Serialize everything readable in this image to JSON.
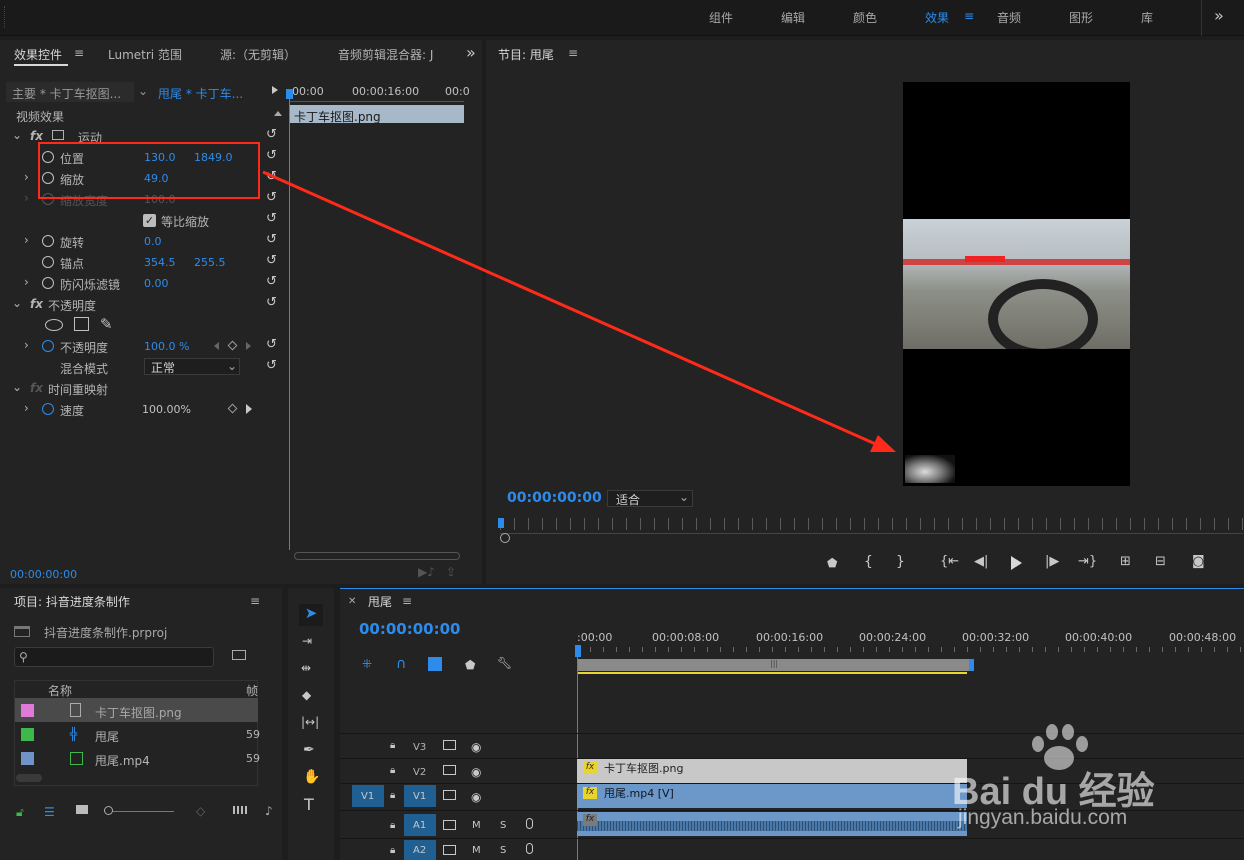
{
  "workspaces": {
    "items": [
      "组件",
      "编辑",
      "颜色",
      "效果",
      "音频",
      "图形",
      "库"
    ],
    "active": "效果",
    "more": "»"
  },
  "ec": {
    "tabs": [
      "效果控件",
      "Lumetri 范围",
      "源:（无剪辑）",
      "音频剪辑混合器: J"
    ],
    "more": "»",
    "master": "主要 * 卡丁车抠图...",
    "clip": "甩尾 * 卡丁车...",
    "ruler": [
      "00:00",
      "00:00:16:00",
      "00:0"
    ],
    "clip_bar": "卡丁车抠图.png",
    "video_effects": "视频效果",
    "motion": "运动",
    "position": {
      "label": "位置",
      "x": "130.0",
      "y": "1849.0"
    },
    "scale": {
      "label": "缩放",
      "value": "49.0"
    },
    "scale_width": {
      "label": "缩放宽度",
      "value": "100.0"
    },
    "uniform": "等比缩放",
    "rotation": {
      "label": "旋转",
      "value": "0.0"
    },
    "anchor": {
      "label": "锚点",
      "x": "354.5",
      "y": "255.5"
    },
    "flicker": {
      "label": "防闪烁滤镜",
      "value": "0.00"
    },
    "opacity_group": "不透明度",
    "opacity": {
      "label": "不透明度",
      "value": "100.0 %"
    },
    "blend": {
      "label": "混合模式",
      "value": "正常"
    },
    "time_remap": "时间重映射",
    "speed": {
      "label": "速度",
      "value": "100.00%"
    },
    "timecode": "00:00:00:00"
  },
  "program": {
    "title": "节目: 甩尾",
    "timecode": "00:00:00:00",
    "fit": "适合"
  },
  "project": {
    "title": "项目: 抖音进度条制作",
    "file": "抖音进度条制作.prproj",
    "col_name": "名称",
    "col_fps": "帧",
    "items": [
      {
        "name": "卡丁车抠图.png",
        "color": "#e07ad8",
        "fps": ""
      },
      {
        "name": "甩尾",
        "color": "#3db84a",
        "fps": "59"
      },
      {
        "name": "甩尾.mp4",
        "color": "#6e94c8",
        "fps": "59"
      }
    ]
  },
  "timeline": {
    "title": "甩尾",
    "timecode": "00:00:00:00",
    "ruler": [
      ":00:00",
      "00:00:08:00",
      "00:00:16:00",
      "00:00:24:00",
      "00:00:32:00",
      "00:00:40:00",
      "00:00:48:00"
    ],
    "tracks": [
      {
        "name": "V3",
        "src": ""
      },
      {
        "name": "V2",
        "src": ""
      },
      {
        "name": "V1",
        "src": "V1"
      },
      {
        "name": "A1",
        "src": ""
      },
      {
        "name": "A2",
        "src": ""
      }
    ],
    "clip_v2": "卡丁车抠图.png",
    "clip_v1": "甩尾.mp4 [V]",
    "m": "M",
    "s": "S"
  },
  "watermark": {
    "main": "Bai du 经验",
    "sub": "jingyan.baidu.com"
  },
  "colors": {
    "accent": "#2d8ceb",
    "annotation": "#ff2a1a",
    "clip_v1": "#6b97c9",
    "clip_audio": "#6b97c9"
  }
}
